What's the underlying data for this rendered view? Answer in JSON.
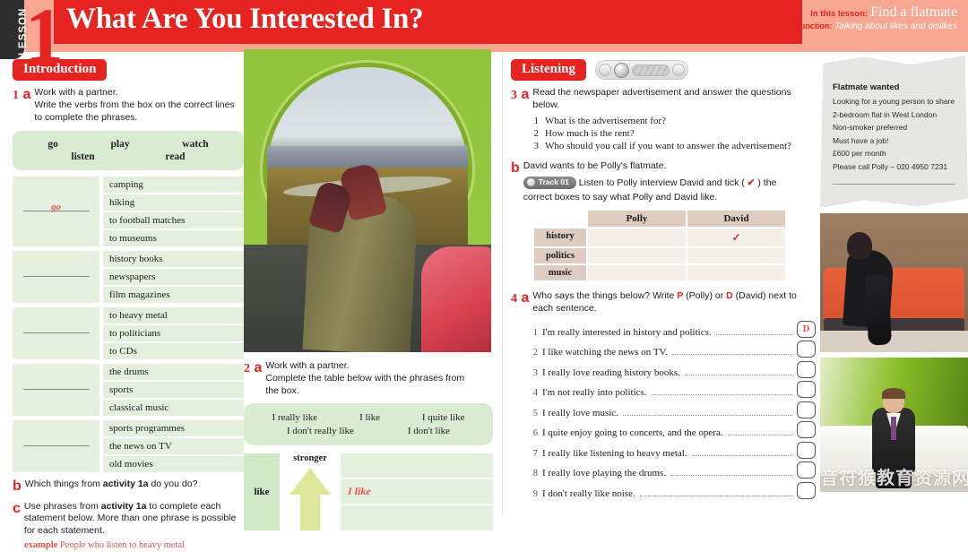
{
  "header": {
    "lesson_tab": "LESSON",
    "lesson_number": "1",
    "title": "What Are You Interested In?",
    "in_this_lesson_label": "In this lesson:",
    "in_this_lesson_value": "Find a flatmate",
    "function_label": "Function:",
    "function_value": "Talking about likes and dislikes"
  },
  "introduction": {
    "pill": "Introduction",
    "task1": {
      "number": "1",
      "letter": "a",
      "line1": "Work with a partner.",
      "line2": "Write the verbs from the box on the correct lines",
      "line3": "to complete the phrases."
    },
    "verb_box": {
      "row1": [
        "go",
        "play",
        "watch"
      ],
      "row2": [
        "listen",
        "read"
      ]
    },
    "phrase_groups": [
      {
        "answer": "go",
        "items": [
          "camping",
          "hiking",
          "to football matches",
          "to museums"
        ]
      },
      {
        "answer": "",
        "items": [
          "history books",
          "newspapers",
          "film magazines"
        ]
      },
      {
        "answer": "",
        "items": [
          "to heavy metal",
          "to politicians",
          "to CDs"
        ]
      },
      {
        "answer": "",
        "items": [
          "the drums",
          "sports",
          "classical music"
        ]
      },
      {
        "answer": "",
        "items": [
          "sports programmes",
          "the news on TV",
          "old movies"
        ]
      }
    ],
    "task1b": {
      "letter": "b",
      "text_pre": "Which things from ",
      "text_bold": "activity 1a",
      "text_post": " do you do?"
    },
    "task1c": {
      "letter": "c",
      "text_pre": "Use phrases from ",
      "text_bold": "activity 1a",
      "text_post": " to complete each statement below. More than one phrase is possible for each statement.",
      "example_label": "example",
      "example_text": "People who listen to heavy metal"
    }
  },
  "task2": {
    "number": "2",
    "letter": "a",
    "line1": "Work with a partner.",
    "line2": "Complete the table below with the phrases from",
    "line3": "the box.",
    "phrase_box": {
      "row1": [
        "I really like",
        "I like",
        "I quite like"
      ],
      "row2": [
        "I don't really like",
        "I don't like"
      ]
    },
    "ladder": {
      "left_label": "like",
      "stronger_label": "stronger",
      "filled_answer": "I like"
    }
  },
  "listening": {
    "pill": "Listening",
    "player": {
      "play_icon": "play-icon",
      "settings_icon": "settings-icon"
    },
    "task3a": {
      "number": "3",
      "letter": "a",
      "text": "Read the newspaper advertisement and answer the questions below.",
      "questions": [
        {
          "n": "1",
          "text": "What is the advertisement for?"
        },
        {
          "n": "2",
          "text": "How much is the rent?"
        },
        {
          "n": "3",
          "text": "Who should you call if you want to answer the advertisement?"
        }
      ]
    },
    "task3b": {
      "letter": "b",
      "line1": "David wants to be Polly's flatmate.",
      "track_label": "Track 01",
      "line2_pre": "Listen to Polly interview David and tick ( ",
      "tick": "✔",
      "line2_post": " ) the",
      "line3": "correct boxes to say what Polly and David like."
    },
    "pd_table": {
      "columns": [
        "Polly",
        "David"
      ],
      "rows": [
        {
          "label": "history",
          "polly": "",
          "david": "✓"
        },
        {
          "label": "politics",
          "polly": "",
          "david": ""
        },
        {
          "label": "music",
          "polly": "",
          "david": ""
        }
      ]
    },
    "task4a": {
      "number": "4",
      "letter": "a",
      "line1_pre": "Who says the things below? Write ",
      "p_letter": "P",
      "line1_mid": " (Polly) or ",
      "d_letter": "D",
      "line1_post": " (David) next to",
      "line2": "each sentence.",
      "statements": [
        {
          "n": "1",
          "text": "I'm really interested in history and politics.",
          "answer": "D"
        },
        {
          "n": "2",
          "text": "I like watching the news on TV.",
          "answer": ""
        },
        {
          "n": "3",
          "text": "I really love reading history books.",
          "answer": ""
        },
        {
          "n": "4",
          "text": "I'm not really into politics.",
          "answer": ""
        },
        {
          "n": "5",
          "text": "I really love music.",
          "answer": ""
        },
        {
          "n": "6",
          "text": "I quite enjoy going to concerts, and the opera.",
          "answer": ""
        },
        {
          "n": "7",
          "text": "I really like listening to heavy metal.",
          "answer": ""
        },
        {
          "n": "8",
          "text": "I really love playing the drums.",
          "answer": ""
        },
        {
          "n": "9",
          "text": "I don't really like noise.",
          "answer": ""
        }
      ]
    }
  },
  "advertisement": {
    "title": "Flatmate wanted",
    "lines": [
      "Looking for a young person to share",
      "2-bedroom flat in West London",
      "Non-smoker preferred",
      "Must have a job!",
      "£600 per month",
      "Please call Polly – 020 4950 7231"
    ]
  },
  "photos": {
    "tent": "view-from-inside-tent-photo",
    "goth": "woman-on-orange-sofa-photo",
    "suit": "man-in-suit-on-white-sofa-photo"
  },
  "watermark": "音符猴教育资源网",
  "colors": {
    "brand_red": "#e52421",
    "header_peach": "#f7a691",
    "green_box": "#d8ecd2",
    "green_cell": "#e4f0de",
    "tan_header": "#ddccbf",
    "answer_red": "#e5554b"
  }
}
